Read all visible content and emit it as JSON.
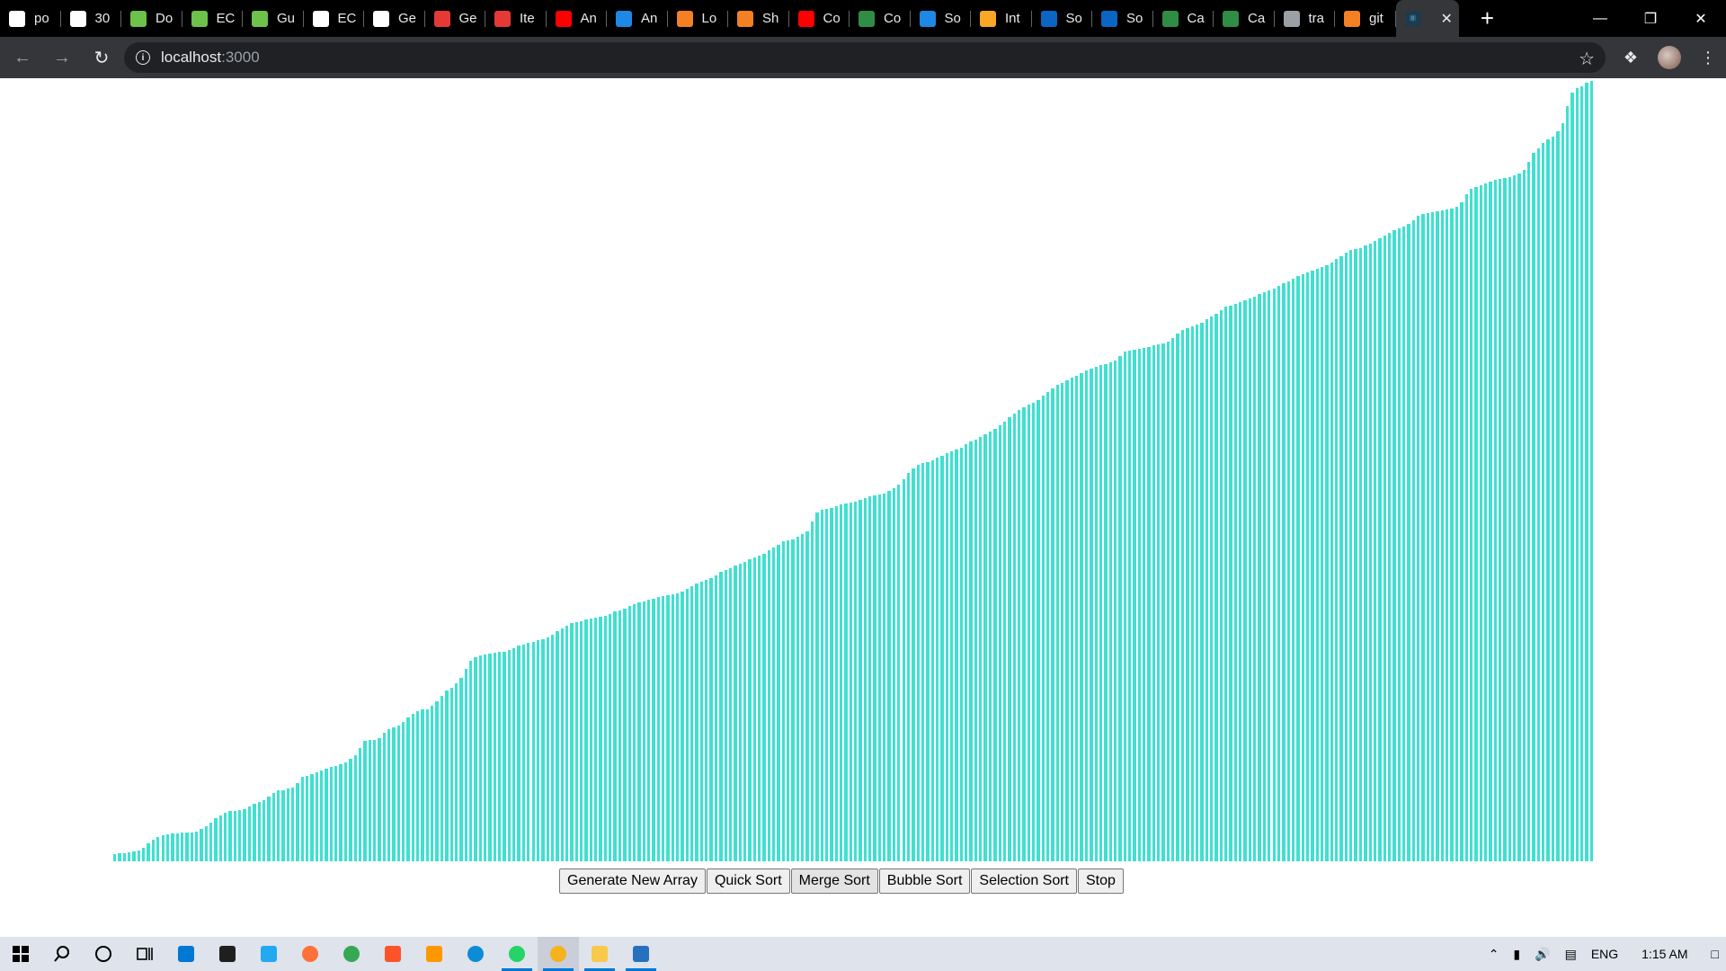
{
  "browser": {
    "tabs": [
      {
        "label": "po",
        "icon": "google-icon",
        "color": "#ffffff"
      },
      {
        "label": "30",
        "icon": "site-icon",
        "color": "#ffffff"
      },
      {
        "label": "Do",
        "icon": "nodejs-icon",
        "color": "#6cc24a"
      },
      {
        "label": "EC",
        "icon": "nodejs-icon",
        "color": "#6cc24a"
      },
      {
        "label": "Gu",
        "icon": "nodejs-icon",
        "color": "#6cc24a"
      },
      {
        "label": "EC",
        "icon": "wikipedia-icon",
        "color": "#ffffff"
      },
      {
        "label": "Ge",
        "icon": "wikipedia-icon",
        "color": "#ffffff"
      },
      {
        "label": "Ge",
        "icon": "figure-icon",
        "color": "#e53935"
      },
      {
        "label": "Ite",
        "icon": "figure-icon",
        "color": "#e53935"
      },
      {
        "label": "An",
        "icon": "youtube-icon",
        "color": "#ff0000"
      },
      {
        "label": "An",
        "icon": "cloud-icon",
        "color": "#1e88e5"
      },
      {
        "label": "Lo",
        "icon": "stackoverflow-icon",
        "color": "#f48024"
      },
      {
        "label": "Sh",
        "icon": "stackoverflow-icon",
        "color": "#f48024"
      },
      {
        "label": "Co",
        "icon": "youtube-icon",
        "color": "#ff0000"
      },
      {
        "label": "Co",
        "icon": "geeks-icon",
        "color": "#2f8d46"
      },
      {
        "label": "So",
        "icon": "feather-icon",
        "color": "#1e88e5"
      },
      {
        "label": "Int",
        "icon": "bird-icon",
        "color": "#f9a825"
      },
      {
        "label": "So",
        "icon": "linkedin-icon",
        "color": "#0a66c2"
      },
      {
        "label": "So",
        "icon": "linkedin-icon",
        "color": "#0a66c2"
      },
      {
        "label": "Ca",
        "icon": "geeks-icon",
        "color": "#2f8d46"
      },
      {
        "label": "Ca",
        "icon": "geeks-icon",
        "color": "#2f8d46"
      },
      {
        "label": "tra",
        "icon": "github-icon",
        "color": "#9aa0a6"
      },
      {
        "label": "git",
        "icon": "stackoverflow-icon",
        "color": "#f48024"
      }
    ],
    "address": {
      "host": "localhost",
      "port": ":3000"
    }
  },
  "controls": {
    "generate": "Generate New Array",
    "quick": "Quick Sort",
    "merge": "Merge Sort",
    "bubble": "Bubble Sort",
    "selection": "Selection Sort",
    "stop": "Stop"
  },
  "bar_color": "#40e0d0",
  "array": [
    8,
    9,
    9,
    10,
    11,
    12,
    15,
    20,
    24,
    27,
    29,
    30,
    31,
    31,
    32,
    32,
    32,
    33,
    36,
    39,
    43,
    48,
    51,
    54,
    56,
    56,
    57,
    58,
    61,
    64,
    66,
    68,
    72,
    76,
    79,
    79,
    81,
    82,
    87,
    94,
    95,
    97,
    99,
    101,
    103,
    105,
    106,
    108,
    110,
    114,
    118,
    126,
    134,
    135,
    135,
    137,
    143,
    147,
    149,
    151,
    155,
    160,
    164,
    167,
    169,
    169,
    173,
    178,
    184,
    190,
    193,
    198,
    204,
    214,
    223,
    227,
    229,
    230,
    231,
    232,
    233,
    233,
    235,
    237,
    240,
    241,
    243,
    244,
    246,
    247,
    249,
    252,
    256,
    259,
    262,
    265,
    266,
    267,
    269,
    270,
    271,
    272,
    273,
    275,
    278,
    279,
    281,
    284,
    286,
    288,
    289,
    291,
    292,
    294,
    295,
    296,
    297,
    298,
    300,
    303,
    306,
    309,
    311,
    313,
    315,
    318,
    322,
    324,
    326,
    329,
    331,
    333,
    336,
    338,
    340,
    342,
    346,
    349,
    352,
    356,
    357,
    358,
    361,
    364,
    367,
    378,
    388,
    391,
    392,
    393,
    395,
    397,
    398,
    399,
    400,
    402,
    404,
    406,
    407,
    408,
    409,
    412,
    415,
    419,
    425,
    432,
    437,
    441,
    443,
    444,
    446,
    449,
    451,
    454,
    456,
    458,
    460,
    464,
    467,
    469,
    472,
    475,
    478,
    481,
    485,
    489,
    494,
    498,
    502,
    505,
    508,
    510,
    513,
    518,
    522,
    526,
    530,
    532,
    535,
    538,
    540,
    543,
    546,
    548,
    550,
    552,
    553,
    555,
    557,
    562,
    567,
    568,
    569,
    570,
    571,
    572,
    574,
    575,
    576,
    578,
    582,
    587,
    591,
    593,
    595,
    597,
    599,
    603,
    606,
    609,
    613,
    617,
    618,
    620,
    622,
    624,
    626,
    628,
    631,
    633,
    635,
    637,
    640,
    643,
    645,
    648,
    651,
    653,
    655,
    657,
    659,
    661,
    663,
    666,
    670,
    673,
    677,
    680,
    681,
    682,
    685,
    687,
    690,
    693,
    696,
    699,
    702,
    704,
    706,
    709,
    713,
    718,
    720,
    721,
    722,
    723,
    724,
    725,
    726,
    728,
    733,
    742,
    748,
    750,
    752,
    754,
    756,
    758,
    759,
    760,
    761,
    763,
    765,
    769,
    778,
    788,
    793,
    799,
    803,
    806,
    812,
    821,
    840,
    855,
    860,
    862,
    866,
    868
  ]
}
